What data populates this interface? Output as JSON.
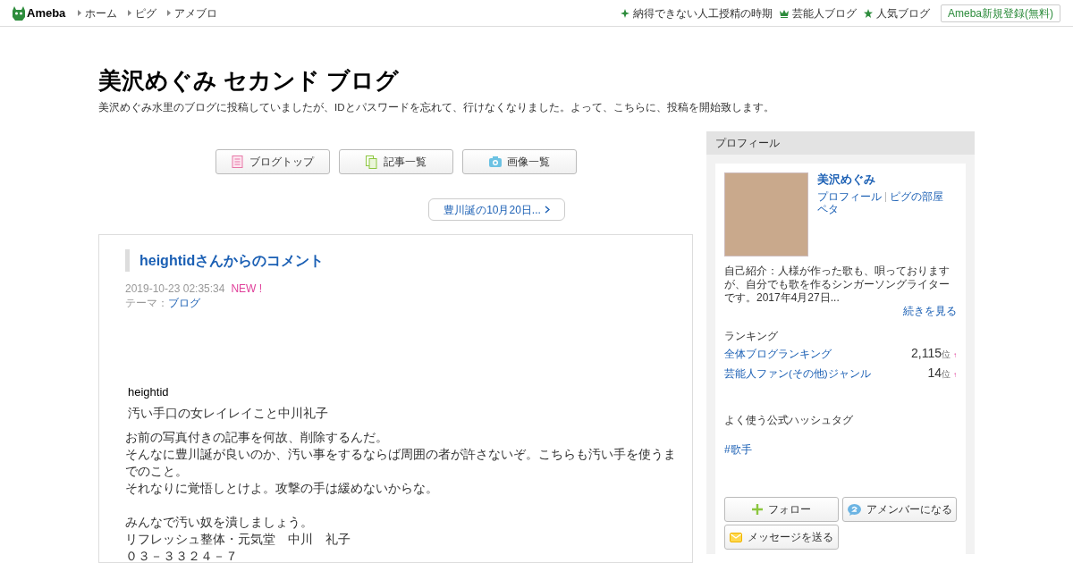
{
  "top_bar": {
    "logo": "Ameba",
    "nav": [
      "ホーム",
      "ピグ",
      "アメブロ"
    ],
    "links": [
      {
        "kind": "sparkle",
        "label": "納得できない人工授精の時期"
      },
      {
        "kind": "crown",
        "label": "芸能人ブログ"
      },
      {
        "kind": "star",
        "label": "人気ブログ"
      }
    ],
    "signup": "Ameba新規登録(無料)"
  },
  "blog": {
    "title": "美沢めぐみ セカンド ブログ",
    "description": "美沢めぐみ水里のブログに投稿していましたが、IDとパスワードを忘れて、行けなくなりました。よって、こちらに、投稿を開始致します。"
  },
  "blog_nav": [
    {
      "kind": "list",
      "label": "ブログトップ"
    },
    {
      "kind": "copy",
      "label": "記事一覧"
    },
    {
      "kind": "camera",
      "label": "画像一覧"
    }
  ],
  "next_post": "豊川誕の10月20日...",
  "article": {
    "title": "heightidさんからのコメント",
    "date": "2019-10-23 02:35:34",
    "badge": "NEW !",
    "theme_label": "テーマ：",
    "theme": "ブログ",
    "author": "heightid",
    "subject": "汚い手口の女レイレイこと中川礼子",
    "paragraphs": [
      [
        "お前の写真付きの記事を何故、削除するんだ。",
        "そんなに豊川誕が良いのか、汚い事をするならば周囲の者が許さないぞ。こちらも汚い手を使うまでのこと。",
        "それなりに覚悟しとけよ。攻撃の手は緩めないからな。"
      ],
      [
        "みんなで汚い奴を潰しましょう。",
        "リフレッシュ整体・元気堂　中川　礼子",
        "０３－３３２４－７"
      ]
    ]
  },
  "profile": {
    "heading": "プロフィール",
    "name": "美沢めぐみ",
    "links": [
      "プロフィール",
      "ピグの部屋"
    ],
    "peta": "ペタ",
    "intro": "自己紹介：人様が作った歌も、唄っておりますが、自分でも歌を作るシンガーソングライターです。2017年4月27日...",
    "more": "続きを見る",
    "ranking_heading": "ランキング",
    "rankings": [
      {
        "label": "全体ブログランキング",
        "rank": "2,115",
        "unit": "位",
        "arrow": "↑"
      },
      {
        "label": "芸能人ファン(その他)ジャンル",
        "rank": "14",
        "unit": "位",
        "arrow": "↑"
      }
    ],
    "hashtag_heading": "よく使う公式ハッシュタグ",
    "hashtags": [
      "#歌手"
    ],
    "buttons": [
      {
        "kind": "follow",
        "label": "フォロー"
      },
      {
        "kind": "amember",
        "label": "アメンバーになる"
      },
      {
        "kind": "message",
        "label": "メッセージを送る"
      }
    ]
  }
}
